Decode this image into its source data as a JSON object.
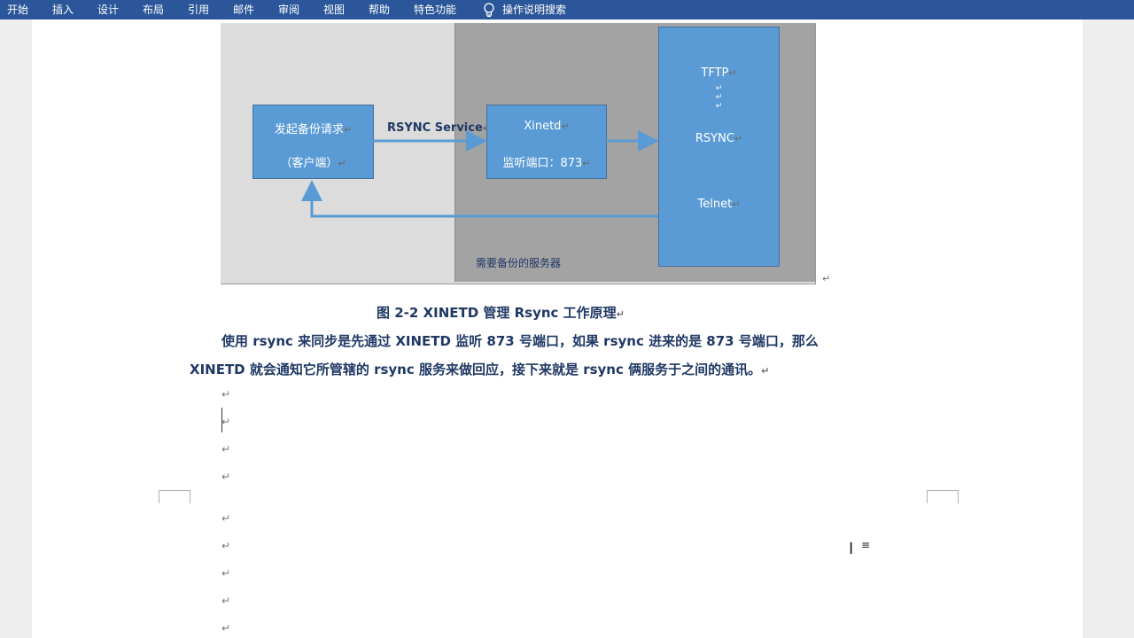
{
  "ribbon": {
    "tabs": [
      "开始",
      "插入",
      "设计",
      "布局",
      "引用",
      "邮件",
      "审阅",
      "视图",
      "帮助",
      "特色功能"
    ],
    "search_label": "操作说明搜索",
    "search_icon": "lightbulb-icon"
  },
  "diagram": {
    "client_box": {
      "line1": "发起备份请求",
      "line2": "（客户端）"
    },
    "rsync_service_label": "RSYNC Service",
    "xinetd_box": {
      "line1": "Xinetd",
      "line2": "监听端口：873"
    },
    "services_box": {
      "item1": "TFTP",
      "item2": "RSYNC",
      "item3": "Telnet"
    },
    "server_label": "需要备份的服务器",
    "colors": {
      "box": "#5b9bd5",
      "server_zone": "#a3a3a3",
      "background": "#dcdcdc",
      "text": "#1f3864"
    }
  },
  "document": {
    "caption": "图  2-2 XINETD 管理 Rsync 工作原理",
    "para_line1": "使用 rsync 来同步是先通过 XINETD 监听 873 号端口，如果 rsync 进来的是 873 号端口，那么",
    "para_line2": "XINETD 就会通知它所管辖的 rsync 服务来做回应，接下来就是 rsync 俩服务于之间的通讯。",
    "return_mark": "↵"
  }
}
